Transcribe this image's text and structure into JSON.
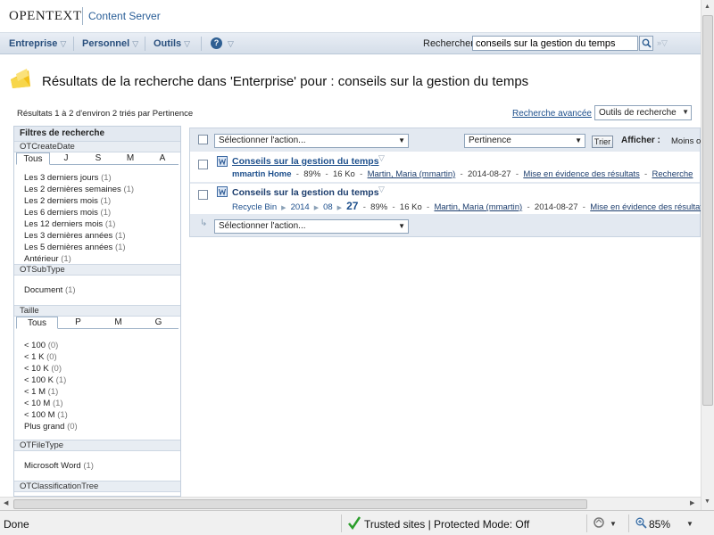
{
  "header": {
    "logo": "OPENTEXT",
    "product": "Content Server"
  },
  "nav": {
    "menus": [
      "Entreprise",
      "Personnel",
      "Outils"
    ],
    "search_label": "Rechercher",
    "search_value": "conseils sur la gestion du temps"
  },
  "page": {
    "title": "Résultats de la recherche dans 'Enterprise' pour : conseils sur la gestion du temps",
    "result_count": "Résultats 1 à 2 d'environ 2 triés par Pertinence",
    "advanced_search": "Recherche avancée",
    "tools": "Outils de recherche"
  },
  "filters": {
    "title": "Filtres de recherche",
    "facets": [
      {
        "name": "OTCreateDate",
        "tabs": [
          "Tous",
          "J",
          "S",
          "M",
          "A"
        ],
        "items": [
          {
            "label": "Les 3 derniers jours",
            "count": "(1)"
          },
          {
            "label": "Les 2 dernières semaines",
            "count": "(1)"
          },
          {
            "label": "Les 2 derniers mois",
            "count": "(1)"
          },
          {
            "label": "Les 6 derniers mois",
            "count": "(1)"
          },
          {
            "label": "Les 12 derniers mois",
            "count": "(1)"
          },
          {
            "label": "Les 3 dernières années",
            "count": "(1)"
          },
          {
            "label": "Les 5 dernières années",
            "count": "(1)"
          },
          {
            "label": "Antérieur",
            "count": "(1)"
          }
        ]
      },
      {
        "name": "OTSubType",
        "items": [
          {
            "label": "Document",
            "count": "(1)"
          }
        ]
      },
      {
        "name": "Taille",
        "tabs": [
          "Tous",
          "P",
          "M",
          "G"
        ],
        "items": [
          {
            "label": "< 100",
            "count": "(0)"
          },
          {
            "label": "< 1 K",
            "count": "(0)"
          },
          {
            "label": "< 10 K",
            "count": "(0)"
          },
          {
            "label": "< 100 K",
            "count": "(1)"
          },
          {
            "label": "< 1 M",
            "count": "(1)"
          },
          {
            "label": "< 10 M",
            "count": "(1)"
          },
          {
            "label": "< 100 M",
            "count": "(1)"
          },
          {
            "label": "Plus grand",
            "count": "(0)"
          }
        ]
      },
      {
        "name": "OTFileType",
        "items": [
          {
            "label": "Microsoft Word",
            "count": "(1)"
          }
        ]
      },
      {
        "name": "OTClassificationTree",
        "items": []
      }
    ]
  },
  "results": {
    "action_placeholder": "Sélectionner l'action...",
    "sort_value": "Pertinence",
    "sort_button": "Trier",
    "show_label": "Afficher :",
    "show_value": "Moins o",
    "rows": [
      {
        "title": "Conseils sur la gestion du temps",
        "location": "mmartin Home",
        "score": "89%",
        "size": "16 Ko",
        "author": "Martin, Maria (mmartin)",
        "date": "2014-08-27",
        "highlight": "Mise en évidence des résultats",
        "extra": "Recherche"
      },
      {
        "title": "Conseils sur la gestion du temps",
        "breadcrumb": [
          "Recycle Bin",
          "2014",
          "08",
          "27"
        ],
        "score": "89%",
        "size": "16 Ko",
        "author": "Martin, Maria (mmartin)",
        "date": "2014-08-27",
        "highlight": "Mise en évidence des résultats"
      }
    ]
  },
  "statusbar": {
    "status": "Done",
    "zone": "Trusted sites | Protected Mode: Off",
    "zoom": "85%"
  }
}
